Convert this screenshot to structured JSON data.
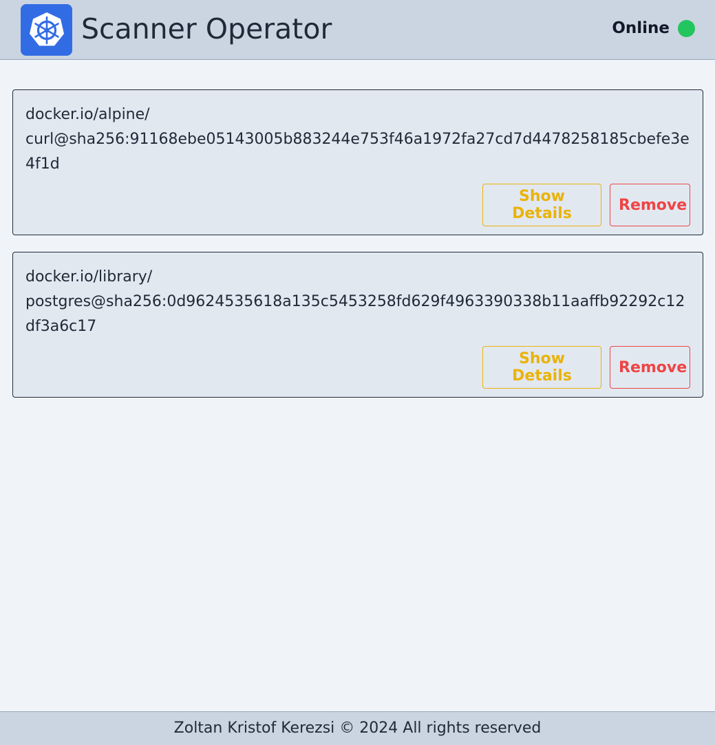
{
  "header": {
    "title": "Scanner Operator",
    "logo_icon": "kubernetes-helm-icon",
    "status_text": "Online",
    "status_color": "#22c55e"
  },
  "images": [
    {
      "name_line1": "docker.io/alpine/",
      "name_line2": "curl@sha256:91168ebe05143005b883244e753f46a1972fa27cd7d4478258185cbefe3e4f1d",
      "details_label": "Show Details",
      "remove_label": "Remove"
    },
    {
      "name_line1": "docker.io/library/",
      "name_line2": "postgres@sha256:0d9624535618a135c5453258fd629f4963390338b11aaffb92292c12df3a6c17",
      "details_label": "Show Details",
      "remove_label": "Remove"
    }
  ],
  "colors": {
    "accent": "#326ce5",
    "details": "#eab308",
    "remove": "#ef4444"
  },
  "footer": {
    "text": "Zoltan Kristof Kerezsi © 2024 All rights reserved"
  }
}
